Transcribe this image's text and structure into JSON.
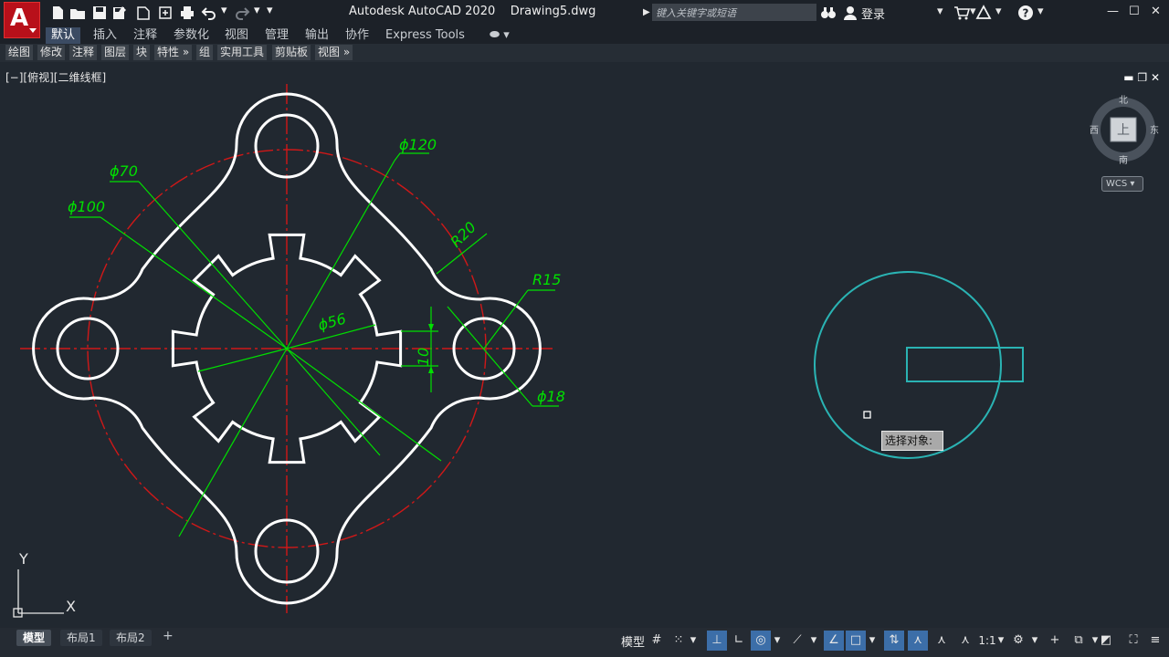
{
  "app": {
    "logo_letter": "A",
    "title": "Autodesk AutoCAD 2020    Drawing5.dwg",
    "search_placeholder": "键入关键字或短语",
    "login": "登录"
  },
  "ribbon": {
    "tabs": [
      "默认",
      "插入",
      "注释",
      "参数化",
      "视图",
      "管理",
      "输出",
      "协作",
      "Express Tools"
    ],
    "active_tab": "默认",
    "panels": [
      "绘图",
      "修改",
      "注释",
      "图层",
      "块",
      "特性 »",
      "组",
      "实用工具",
      "剪贴板",
      "视图 »"
    ]
  },
  "viewport": {
    "label": "[−][俯视][二维线框]",
    "viewcube": {
      "north": "北",
      "south": "南",
      "east": "东",
      "west": "西",
      "top": "上",
      "wcs": "WCS"
    }
  },
  "dimensions": {
    "d120": "ϕ120",
    "d70": "ϕ70",
    "d100": "ϕ100",
    "r20": "R20",
    "r15": "R15",
    "d56": "ϕ56",
    "w10": "10",
    "d18": "ϕ18"
  },
  "ucs": {
    "x_label": "X",
    "y_label": "Y"
  },
  "prompt": {
    "tooltip": "选择对象:"
  },
  "layout_tabs": [
    "模型",
    "布局1",
    "布局2"
  ],
  "status": {
    "model": "模型",
    "scale": "1:1"
  },
  "colors": {
    "drawing_bg": "#212830",
    "geometry": "#ffffff",
    "dimension": "#00e000",
    "centerline": "#d01818",
    "selection": "#2ab3b3",
    "accent_tab": "#3b4b63"
  }
}
